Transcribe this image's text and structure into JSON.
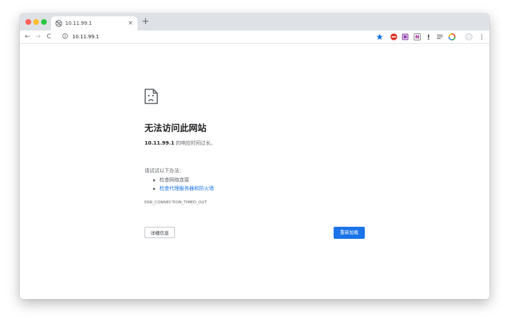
{
  "tab": {
    "title": "10.11.99.1",
    "close_glyph": "×",
    "new_tab_glyph": "+"
  },
  "toolbar": {
    "back_glyph": "←",
    "forward_glyph": "→",
    "reload_glyph": "C",
    "url": "10.11.99.1",
    "extensions": [
      "star-icon",
      "abp-extension-icon",
      "purple-extension-icon",
      "notion-extension-icon",
      "bolt-extension-icon",
      "reader-extension-icon",
      "color-extension-icon",
      "profile-avatar",
      "kebab-menu-icon"
    ],
    "accent": "#1a73e8"
  },
  "error_page": {
    "icon": "sad-page-icon",
    "heading": "无法访问此网站",
    "detail_host": "10.11.99.1",
    "detail_rest": " 的响应时间过长。",
    "suggest_title": "请试试以下办法：",
    "suggestions": [
      {
        "text": "检查网络连接",
        "link": false
      },
      {
        "text": "检查代理服务器和防火墙",
        "link": true
      }
    ],
    "error_code": "ERR_CONNECTION_TIMED_OUT",
    "details_button": "详细信息",
    "reload_button": "重新加载"
  }
}
